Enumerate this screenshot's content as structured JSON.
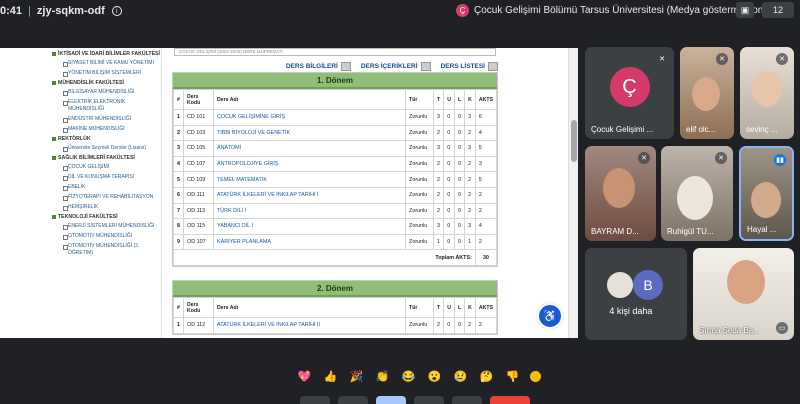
{
  "meet": {
    "time": "0:41",
    "meeting_code": "zjy-sqkm-odf",
    "presenter_label": "Çocuk Gelişimi Bölümü Tarsus Üniversitesi (Medya gösterme kontrolleri)",
    "presenter_initial": "Ç",
    "participant_count": "12"
  },
  "sidebar": {
    "sections": [
      {
        "title": "İKTİSADİ VE İDARİ BİLİMLER FAKÜLTESİ",
        "items": [
          "SİYASET BİLİMİ VE KAMU YÖNETİMİ",
          "YÖNETİM BİLİŞİM SİSTEMLERİ"
        ]
      },
      {
        "title": "MÜHENDİSLİK FAKÜLTESİ",
        "items": [
          "BİLGİSAYAR MÜHENDİSLİĞİ",
          "ELEKTRİK ELEKTRONİK MÜHENDİSLİĞİ",
          "ENDÜSTRİ MÜHENDİSLİĞİ",
          "MAKİNE MÜHENDİSLİĞİ"
        ]
      },
      {
        "title": "REKTÖRLÜK",
        "items": [
          "Üniversite Seçmeli Dersler (Lisans)"
        ]
      },
      {
        "title": "SAĞLIK BİLİMLERİ FAKÜLTESİ",
        "items": [
          "ÇOCUK GELİŞİMİ",
          "DİL VE KONUŞMA TERAPİSİ",
          "EBELİK",
          "FİZYOTERAPİ VE REHABİLİTASYON",
          "HEMŞİRELİK"
        ]
      },
      {
        "title": "TEKNOLOJİ FAKÜLTESİ",
        "items": [
          "ENERJİ SİSTEMLERİ MÜHENDİSLİĞİ",
          "OTOMOTİV MÜHENDİSLİĞİ",
          "OTOMOTİV MÜHENDİSLİĞİ (2. ÖĞRETİM)"
        ]
      }
    ]
  },
  "page": {
    "select_value": "ÇOCUK GELİŞİMİ (2024-2025) DERS MÜFREDATI",
    "links": [
      "DERS BİLGİLERİ",
      "DERS İÇERİKLERİ",
      "DERS LİSTESİ"
    ]
  },
  "table_headers": [
    "#",
    "Ders Kodu",
    "Ders Adı",
    "Tür",
    "T",
    "U",
    "L",
    "K",
    "AKTS"
  ],
  "term1": {
    "title": "1. Dönem",
    "rows": [
      [
        "1",
        "CD 101",
        "ÇOCUK GELİŞİMİNE GİRİŞ",
        "Zorunlu",
        "3",
        "0",
        "0",
        "3",
        "6"
      ],
      [
        "2",
        "CD 103",
        "TIBBİ BİYOLOJİ VE GENETİK",
        "Zorunlu",
        "2",
        "0",
        "0",
        "2",
        "4"
      ],
      [
        "3",
        "CD 105",
        "ANATOMİ",
        "Zorunlu",
        "3",
        "0",
        "0",
        "3",
        "5"
      ],
      [
        "4",
        "CD 107",
        "ANTROPOLOJİYE GİRİŞ",
        "Zorunlu",
        "2",
        "0",
        "0",
        "2",
        "3"
      ],
      [
        "5",
        "CD 109",
        "TEMEL MATEMATİK",
        "Zorunlu",
        "2",
        "0",
        "0",
        "2",
        "5"
      ],
      [
        "6",
        "OD 111",
        "ATATÜRK İLKELERİ VE İNKILAP TARİHİ I",
        "Zorunlu",
        "2",
        "0",
        "0",
        "2",
        "2"
      ],
      [
        "7",
        "OD 113",
        "TÜRK DİLİ I",
        "Zorunlu",
        "2",
        "0",
        "0",
        "2",
        "2"
      ],
      [
        "8",
        "OD 115",
        "YABANCI DİL I",
        "Zorunlu",
        "3",
        "0",
        "0",
        "3",
        "4"
      ],
      [
        "9",
        "OD 107",
        "KARİYER PLANLAMA",
        "Zorunlu",
        "1",
        "0",
        "0",
        "1",
        "2"
      ]
    ],
    "total_label": "Toplam AKTS:",
    "total_value": "30"
  },
  "term2": {
    "title": "2. Dönem",
    "rows": [
      [
        "1",
        "OD 112",
        "ATATÜRK İLKELERİ VE İNKILAP TARİHİ II",
        "Zorunlu",
        "2",
        "0",
        "0",
        "2",
        "2"
      ]
    ]
  },
  "participants": {
    "presenter_tile_name": "Çocuk Gelişimi ...",
    "p1": "elif olc...",
    "p2": "sevinç ...",
    "p3": "BAYRAM D...",
    "p4": "Ruhigül TU...",
    "p5": "Hayal ...",
    "more_label": "4 kişi daha",
    "more_avatar": "B",
    "p6": "Sırma Seda Ba..."
  },
  "reactions": [
    "💖",
    "👍",
    "🎉",
    "👏",
    "😂",
    "😮",
    "😢",
    "🤔",
    "👎"
  ]
}
